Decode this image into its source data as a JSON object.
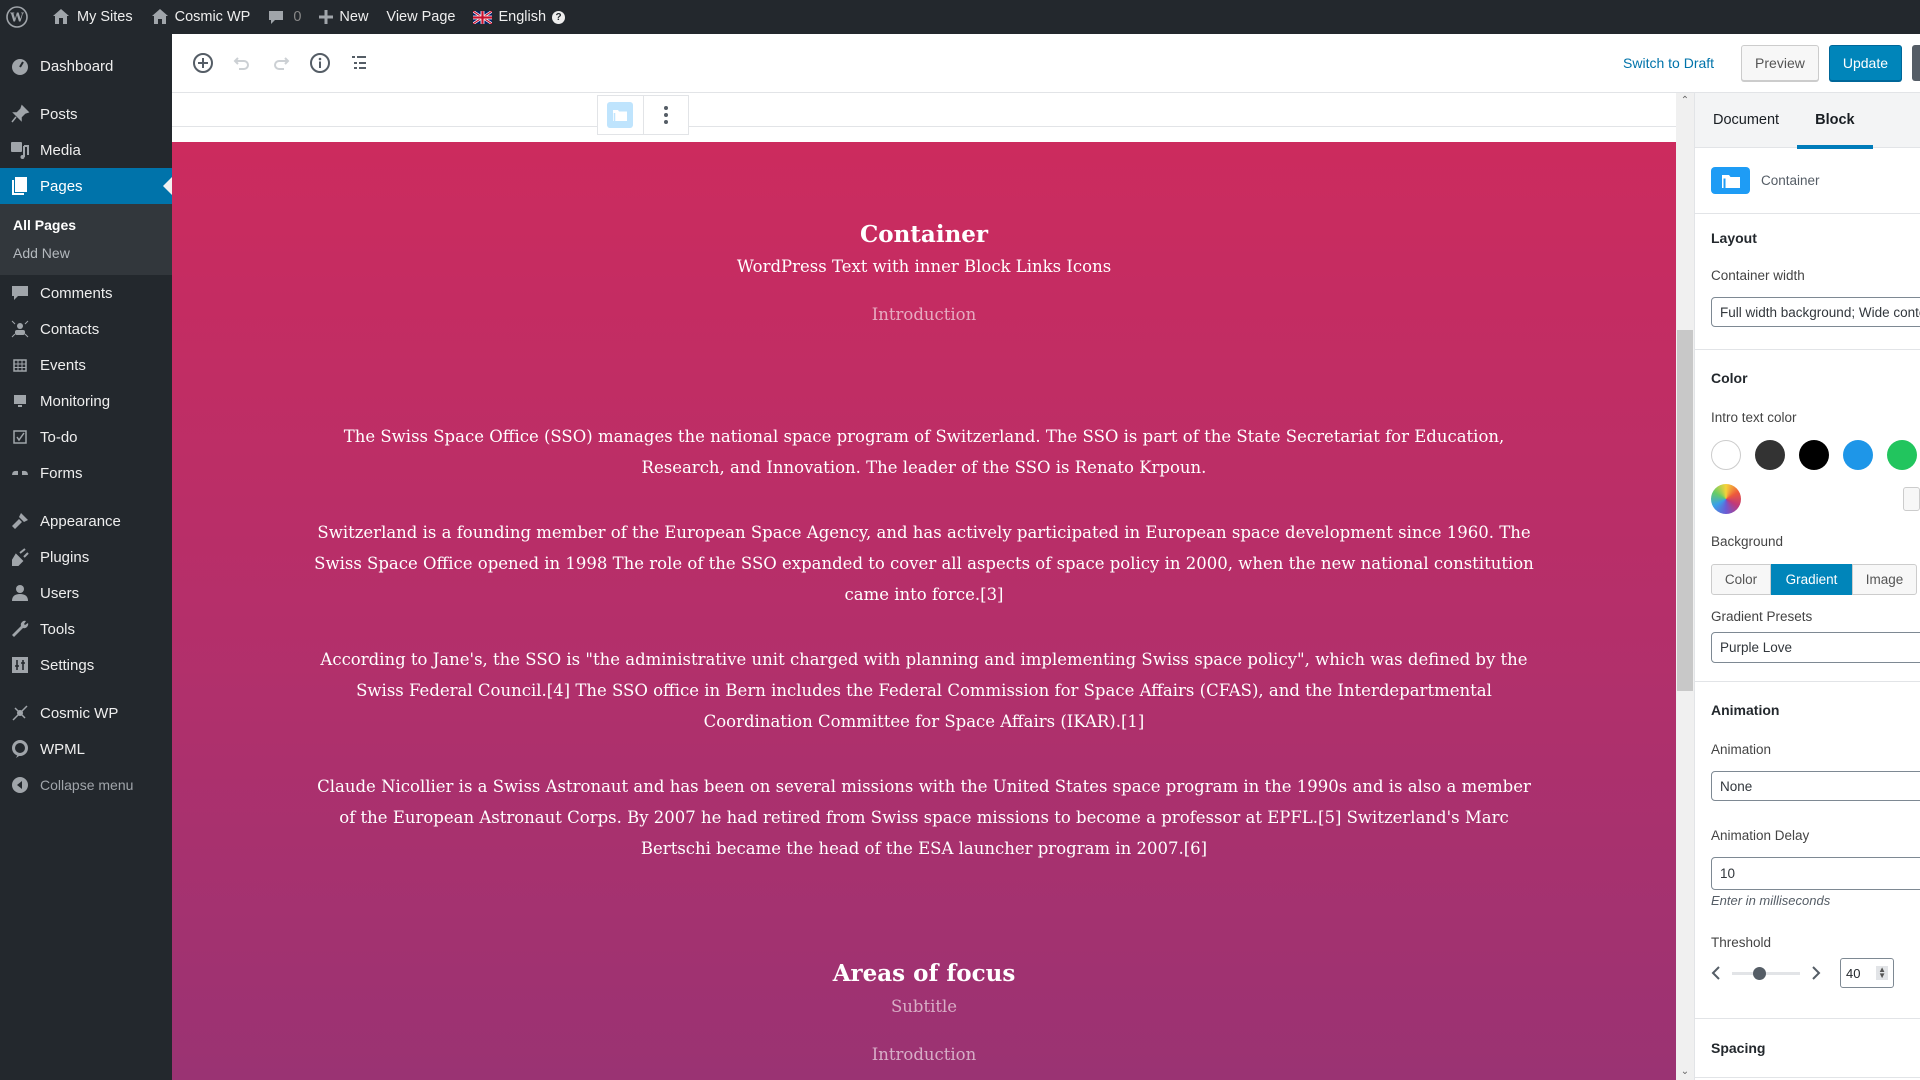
{
  "adminbar": {
    "my_sites": "My Sites",
    "site_name": "Cosmic WP",
    "comments_count": "0",
    "new": "New",
    "view_page": "View Page",
    "language": "English",
    "help": "?"
  },
  "sidebar": {
    "items": [
      {
        "label": "Dashboard",
        "icon": "dashboard-icon"
      },
      {
        "label": "Posts",
        "icon": "pin-icon"
      },
      {
        "label": "Media",
        "icon": "media-icon"
      },
      {
        "label": "Pages",
        "icon": "pages-icon",
        "active": true
      },
      {
        "label": "Comments",
        "icon": "comment-icon"
      },
      {
        "label": "Contacts",
        "icon": "contacts-icon"
      },
      {
        "label": "Events",
        "icon": "calendar-icon"
      },
      {
        "label": "Monitoring",
        "icon": "monitor-icon"
      },
      {
        "label": "To-do",
        "icon": "checkbox-icon"
      },
      {
        "label": "Forms",
        "icon": "forms-icon"
      },
      {
        "label": "Appearance",
        "icon": "brush-icon"
      },
      {
        "label": "Plugins",
        "icon": "plugin-icon"
      },
      {
        "label": "Users",
        "icon": "user-icon"
      },
      {
        "label": "Tools",
        "icon": "wrench-icon"
      },
      {
        "label": "Settings",
        "icon": "settings-icon"
      },
      {
        "label": "Cosmic WP",
        "icon": "cosmic-icon"
      },
      {
        "label": "WPML",
        "icon": "wpml-icon"
      }
    ],
    "submenu": [
      "All Pages",
      "Add New"
    ],
    "collapse": "Collapse menu"
  },
  "toolbar": {
    "switch_to_draft": "Switch to Draft",
    "preview": "Preview",
    "update": "Update"
  },
  "content": {
    "title": "Container",
    "subtitle": "WordPress Text with inner Block Links Icons",
    "intro": "Introduction",
    "paragraphs": [
      "The Swiss Space Office (SSO) manages the national space program of Switzerland. The SSO is part of the State Secretariat for Education, Research, and Innovation. The leader of the SSO is Renato Krpoun.",
      "Switzerland is a founding member of the European Space Agency, and has actively participated in European space development since 1960. The Swiss Space Office opened in 1998 The role of the SSO expanded to cover all aspects of space policy in 2000, when the new national constitution came into force.[3]",
      "According to Jane's, the SSO is \"the administrative unit charged with planning and implementing Swiss space policy\", which was defined by the Swiss Federal Council.[4] The SSO office in Bern includes the Federal Commission for Space Affairs (CFAS), and the Interdepartmental Coordination Committee for Space Affairs (IKAR).[1]",
      "Claude Nicollier is a Swiss Astronaut and has been on several missions with the United States space program in the 1990s and is also a member of the European Astronaut Corps. By 2007 he had retired from Swiss space missions to become a professor at EPFL.[5] Switzerland's Marc Bertschi became the head of the ESA launcher program in 2007.[6]"
    ],
    "section2": {
      "title": "Areas of focus",
      "subtitle": "Subtitle",
      "intro": "Introduction"
    }
  },
  "settings": {
    "tabs": [
      "Document",
      "Block"
    ],
    "active_tab": "Block",
    "block_name": "Container",
    "layout": {
      "title": "Layout",
      "container_width_label": "Container width",
      "container_width_value": "Full width background; Wide content"
    },
    "color": {
      "title": "Color",
      "intro_text_color_label": "Intro text color",
      "swatches": [
        "#ffffff",
        "#333333",
        "#000000",
        "#1e96e8",
        "#22c55e"
      ],
      "background_label": "Background",
      "background_options": [
        "Color",
        "Gradient",
        "Image"
      ],
      "background_selected": "Gradient",
      "gradient_presets_label": "Gradient Presets",
      "gradient_preset_value": "Purple Love"
    },
    "animation": {
      "title": "Animation",
      "animation_label": "Animation",
      "animation_value": "None",
      "delay_label": "Animation Delay",
      "delay_value": "10",
      "delay_help": "Enter in milliseconds",
      "threshold_label": "Threshold",
      "threshold_value": "40",
      "threshold_fraction": 0.4
    },
    "spacing_title": "Spacing"
  },
  "colors": {
    "accent": "#0073aa",
    "gradient_start": "#cc2b5e",
    "gradient_end": "#753a88"
  }
}
